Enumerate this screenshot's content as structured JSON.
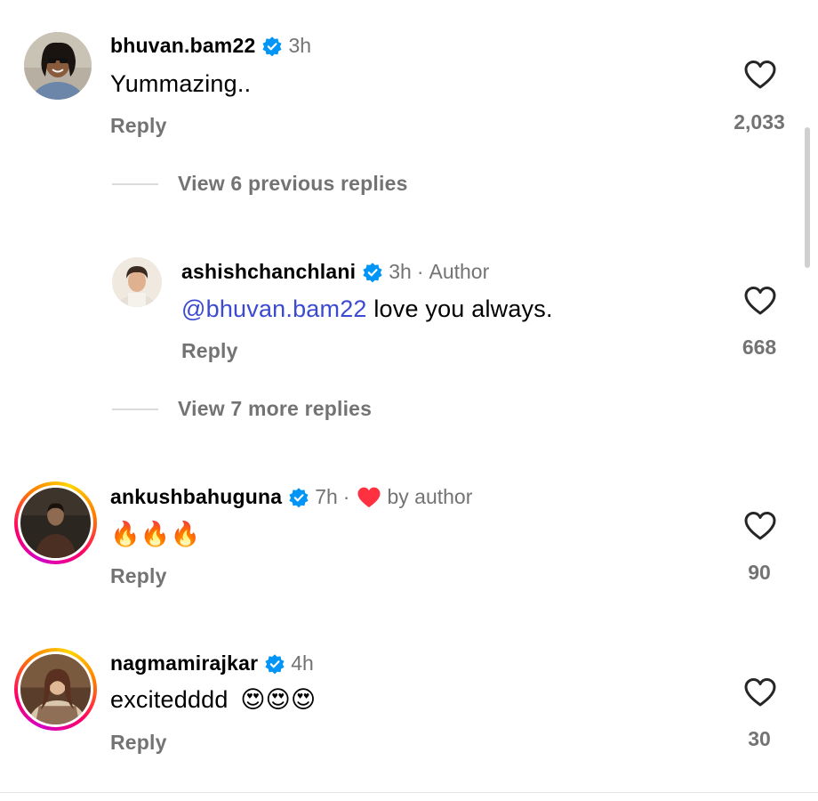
{
  "colors": {
    "text": "#000000",
    "secondary": "#737373",
    "mention": "#3b4ad0",
    "verified": "#0095f6",
    "heart_red": "#ff3040"
  },
  "comments": [
    {
      "username": "bhuvan.bam22",
      "verified": true,
      "time": "3h",
      "text": "Yummazing..",
      "reply_label": "Reply",
      "likes": "2,033",
      "story_ring": false
    },
    {
      "username": "ashishchanchlani",
      "verified": true,
      "time": "3h",
      "separator": "·",
      "author_tag": "Author",
      "mention": "@bhuvan.bam22",
      "text": "love you always.",
      "reply_label": "Reply",
      "likes": "668",
      "story_ring": false
    },
    {
      "username": "ankushbahuguna",
      "verified": true,
      "time": "7h",
      "separator": "·",
      "liked_by_author": "by author",
      "text": "🔥🔥🔥",
      "reply_label": "Reply",
      "likes": "90",
      "story_ring": true
    },
    {
      "username": "nagmamirajkar",
      "verified": true,
      "time": "4h",
      "text": "excitedddd",
      "emoji": "😍😍😍",
      "reply_label": "Reply",
      "likes": "30",
      "story_ring": true
    }
  ],
  "threads": {
    "view_previous": "View 6 previous replies",
    "view_more": "View 7 more replies"
  },
  "icons": {
    "like": "heart-outline-icon",
    "verified": "verified-badge-icon",
    "liked_by_author": "red-heart-icon"
  }
}
